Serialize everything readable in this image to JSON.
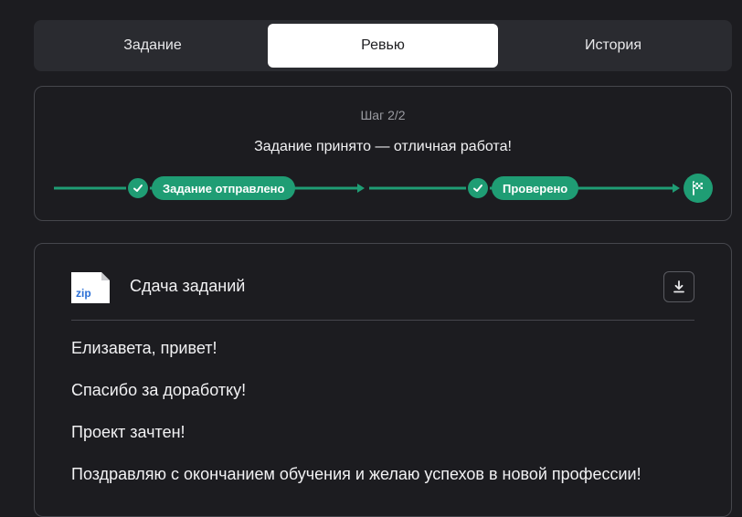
{
  "tabs": [
    {
      "label": "Задание",
      "active": false
    },
    {
      "label": "Ревью",
      "active": true
    },
    {
      "label": "История",
      "active": false
    }
  ],
  "progress": {
    "step_count": "Шаг 2/2",
    "status": "Задание принято — отличная работа!",
    "steps": [
      {
        "label": "Задание отправлено",
        "done": true
      },
      {
        "label": "Проверено",
        "done": true
      }
    ],
    "finish_icon": "finish-flag-icon"
  },
  "submission": {
    "file_type": "zip",
    "file_name": "Сдача заданий",
    "download_icon": "download-icon"
  },
  "review_message": [
    "Елизавета, привет!",
    "Спасибо за доработку!",
    "Проект зачтен!",
    "Поздравляю с окончанием обучения и желаю успехов в новой профессии!"
  ],
  "colors": {
    "background": "#1c1c20",
    "surface": "#2a2b30",
    "accent_green": "#1f9d74",
    "border": "#45464c",
    "text": "#f2f2f4",
    "muted": "#9a9ba1"
  }
}
